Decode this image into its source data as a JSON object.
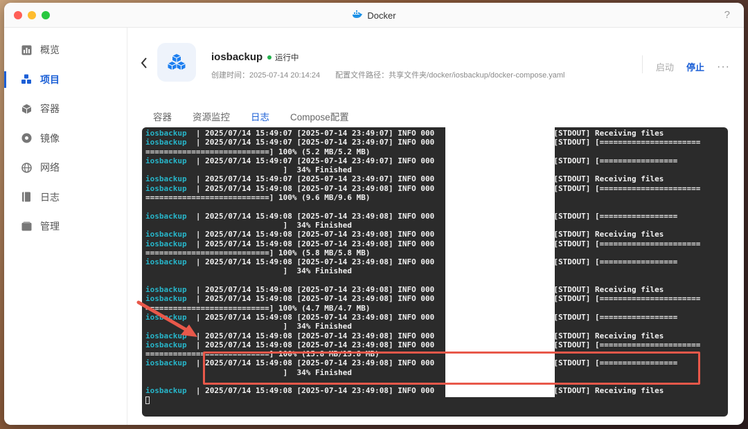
{
  "window": {
    "title": "Docker",
    "help": "?"
  },
  "sidebar": {
    "items": [
      {
        "label": "概览",
        "icon": "bar-chart-icon"
      },
      {
        "label": "项目",
        "icon": "cubes-icon",
        "active": true
      },
      {
        "label": "容器",
        "icon": "box-icon"
      },
      {
        "label": "镜像",
        "icon": "disc-icon"
      },
      {
        "label": "网络",
        "icon": "globe-icon"
      },
      {
        "label": "日志",
        "icon": "book-icon"
      },
      {
        "label": "管理",
        "icon": "folder-icon"
      }
    ]
  },
  "project": {
    "name": "iosbackup",
    "status": "运行中",
    "created_label": "创建时间：",
    "created": "2025-07-14 20:14:24",
    "config_label": "配置文件路径：",
    "config_path": "共享文件夹/docker/iosbackup/docker-compose.yaml"
  },
  "actions": {
    "start": "启动",
    "stop": "停止",
    "more": "···"
  },
  "tabs": [
    {
      "label": "容器"
    },
    {
      "label": "资源监控"
    },
    {
      "label": "日志",
      "active": true
    },
    {
      "label": "Compose配置"
    }
  ],
  "colors": {
    "accent": "#1b5fd6",
    "running": "#22b14c",
    "service": "#27b5c9",
    "highlight": "#e8584a"
  },
  "log": {
    "lines": [
      {
        "svc": "iosbackup",
        "text": "  | 2025/07/14 15:49:07 [2025-07-14 23:49:07] INFO 000                        : [STDOUT] Receiving files"
      },
      {
        "svc": "iosbackup",
        "text": "  | 2025/07/14 15:49:07 [2025-07-14 23:49:07] INFO 000                        : [STDOUT] [======================"
      },
      {
        "svc": "",
        "text": "===========================] 100% (5.2 MB/5.2 MB)"
      },
      {
        "svc": "iosbackup",
        "text": "  | 2025/07/14 15:49:07 [2025-07-14 23:49:07] INFO 000                        : [STDOUT] [================="
      },
      {
        "svc": "",
        "text": "                              ]  34% Finished"
      },
      {
        "svc": "iosbackup",
        "text": "  | 2025/07/14 15:49:07 [2025-07-14 23:49:07] INFO 000                        : [STDOUT] Receiving files"
      },
      {
        "svc": "iosbackup",
        "text": "  | 2025/07/14 15:49:08 [2025-07-14 23:49:08] INFO 000                        : [STDOUT] [======================"
      },
      {
        "svc": "",
        "text": "===========================] 100% (9.6 MB/9.6 MB)"
      },
      {
        "svc": "",
        "text": ""
      },
      {
        "svc": "iosbackup",
        "text": "  | 2025/07/14 15:49:08 [2025-07-14 23:49:08] INFO 000                        : [STDOUT] [================="
      },
      {
        "svc": "",
        "text": "                              ]  34% Finished"
      },
      {
        "svc": "iosbackup",
        "text": "  | 2025/07/14 15:49:08 [2025-07-14 23:49:08] INFO 000                        : [STDOUT] Receiving files"
      },
      {
        "svc": "iosbackup",
        "text": "  | 2025/07/14 15:49:08 [2025-07-14 23:49:08] INFO 000                        : [STDOUT] [======================"
      },
      {
        "svc": "",
        "text": "===========================] 100% (5.8 MB/5.8 MB)"
      },
      {
        "svc": "iosbackup",
        "text": "  | 2025/07/14 15:49:08 [2025-07-14 23:49:08] INFO 000                        : [STDOUT] [================="
      },
      {
        "svc": "",
        "text": "                              ]  34% Finished"
      },
      {
        "svc": "",
        "text": ""
      },
      {
        "svc": "iosbackup",
        "text": "  | 2025/07/14 15:49:08 [2025-07-14 23:49:08] INFO 000                        : [STDOUT] Receiving files"
      },
      {
        "svc": "iosbackup",
        "text": "  | 2025/07/14 15:49:08 [2025-07-14 23:49:08] INFO 000                        : [STDOUT] [======================"
      },
      {
        "svc": "",
        "text": "===========================] 100% (4.7 MB/4.7 MB)"
      },
      {
        "svc": "iosbackup",
        "text": "  | 2025/07/14 15:49:08 [2025-07-14 23:49:08] INFO 000                        : [STDOUT] [================="
      },
      {
        "svc": "",
        "text": "                              ]  34% Finished"
      },
      {
        "svc": "iosbackup",
        "text": "  | 2025/07/14 15:49:08 [2025-07-14 23:49:08] INFO 000                        : [STDOUT] Receiving files"
      },
      {
        "svc": "iosbackup",
        "text": "  | 2025/07/14 15:49:08 [2025-07-14 23:49:08] INFO 000                        : [STDOUT] [======================"
      },
      {
        "svc": "",
        "text": "===========================] 100% (15.8 MB/15.8 MB)"
      },
      {
        "svc": "iosbackup",
        "text": "  | 2025/07/14 15:49:08 [2025-07-14 23:49:08] INFO 000                        : [STDOUT] [================="
      },
      {
        "svc": "",
        "text": "                              ]  34% Finished"
      },
      {
        "svc": "",
        "text": ""
      },
      {
        "svc": "iosbackup",
        "text": "  | 2025/07/14 15:49:08 [2025-07-14 23:49:08] INFO 000                        : [STDOUT] Receiving files"
      }
    ]
  }
}
